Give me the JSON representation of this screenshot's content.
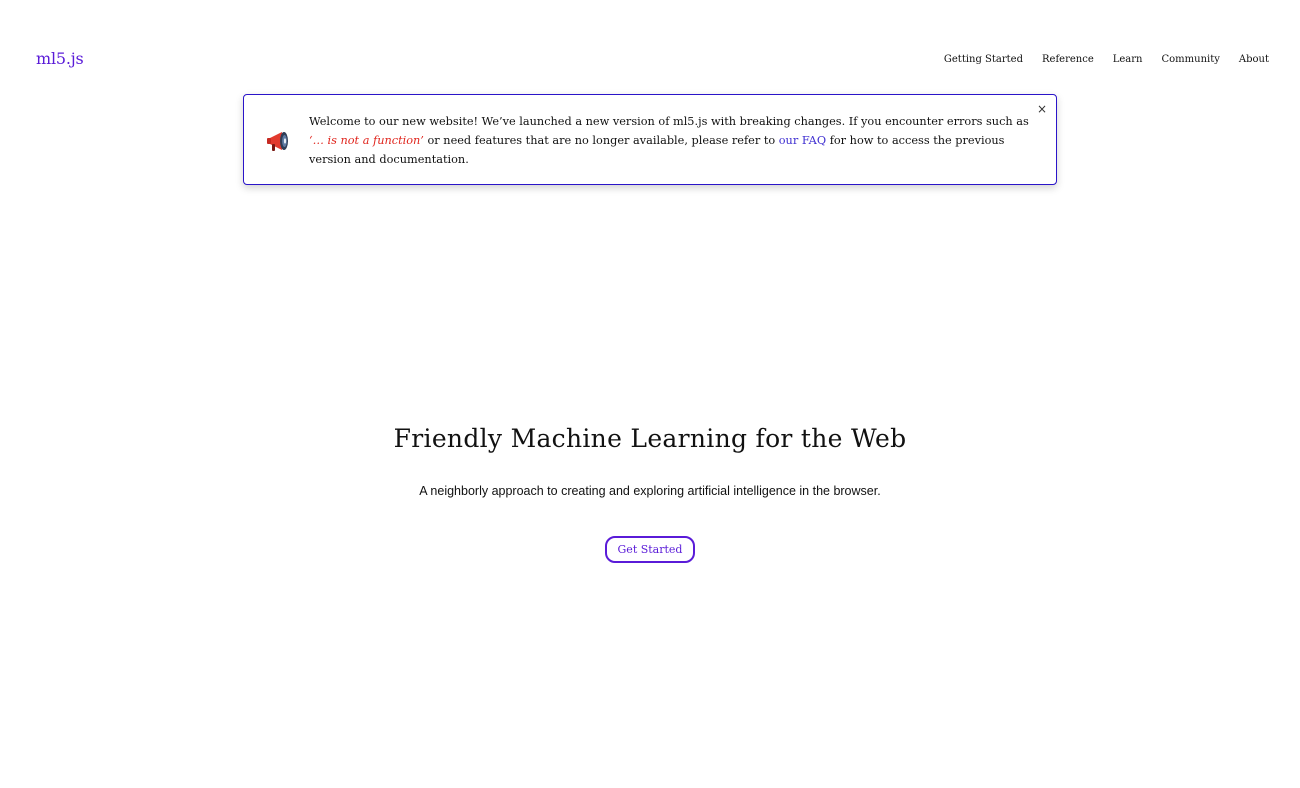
{
  "header": {
    "logo": "ml5.js",
    "nav": [
      {
        "label": "Getting Started"
      },
      {
        "label": "Reference"
      },
      {
        "label": "Learn"
      },
      {
        "label": "Community"
      },
      {
        "label": "About"
      }
    ]
  },
  "banner": {
    "icon": "megaphone-icon",
    "text_part1": "Welcome to our new website! We’ve launched a new version of ml5.js with breaking changes. If you encounter errors such as ",
    "error_example": "‘… is not a function’",
    "text_part2": " or need features that are no longer available, please refer to ",
    "faq_link": "our FAQ",
    "text_part3": " for how to access the previous version and documentation.",
    "close_label": "×"
  },
  "hero": {
    "title": "Friendly Machine Learning for the Web",
    "subtitle": "A neighborly approach to creating and exploring artificial intelligence in the browser.",
    "cta_label": "Get Started"
  },
  "colors": {
    "brand": "#5a1bd8",
    "banner_border": "#2a14c9",
    "error_text": "#e0261e",
    "link": "#3f2fd1"
  }
}
